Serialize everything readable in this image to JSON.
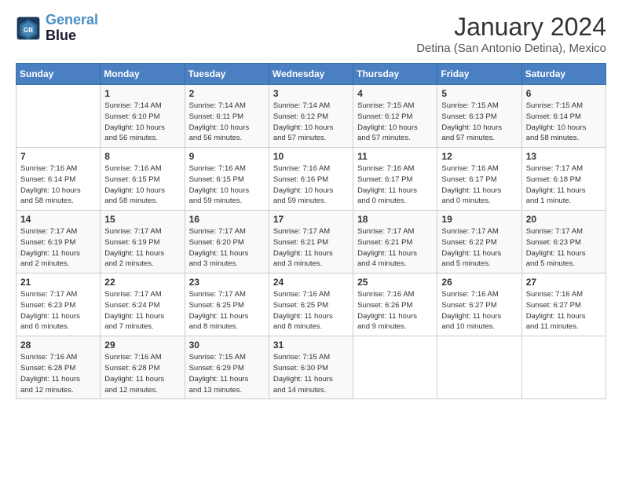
{
  "header": {
    "logo": {
      "line1": "General",
      "line2": "Blue"
    },
    "title": "January 2024",
    "subtitle": "Detina (San Antonio Detina), Mexico"
  },
  "days_of_week": [
    "Sunday",
    "Monday",
    "Tuesday",
    "Wednesday",
    "Thursday",
    "Friday",
    "Saturday"
  ],
  "weeks": [
    [
      {
        "day": "",
        "info": ""
      },
      {
        "day": "1",
        "info": "Sunrise: 7:14 AM\nSunset: 6:10 PM\nDaylight: 10 hours\nand 56 minutes."
      },
      {
        "day": "2",
        "info": "Sunrise: 7:14 AM\nSunset: 6:11 PM\nDaylight: 10 hours\nand 56 minutes."
      },
      {
        "day": "3",
        "info": "Sunrise: 7:14 AM\nSunset: 6:12 PM\nDaylight: 10 hours\nand 57 minutes."
      },
      {
        "day": "4",
        "info": "Sunrise: 7:15 AM\nSunset: 6:12 PM\nDaylight: 10 hours\nand 57 minutes."
      },
      {
        "day": "5",
        "info": "Sunrise: 7:15 AM\nSunset: 6:13 PM\nDaylight: 10 hours\nand 57 minutes."
      },
      {
        "day": "6",
        "info": "Sunrise: 7:15 AM\nSunset: 6:14 PM\nDaylight: 10 hours\nand 58 minutes."
      }
    ],
    [
      {
        "day": "7",
        "info": "Sunrise: 7:16 AM\nSunset: 6:14 PM\nDaylight: 10 hours\nand 58 minutes."
      },
      {
        "day": "8",
        "info": "Sunrise: 7:16 AM\nSunset: 6:15 PM\nDaylight: 10 hours\nand 58 minutes."
      },
      {
        "day": "9",
        "info": "Sunrise: 7:16 AM\nSunset: 6:15 PM\nDaylight: 10 hours\nand 59 minutes."
      },
      {
        "day": "10",
        "info": "Sunrise: 7:16 AM\nSunset: 6:16 PM\nDaylight: 10 hours\nand 59 minutes."
      },
      {
        "day": "11",
        "info": "Sunrise: 7:16 AM\nSunset: 6:17 PM\nDaylight: 11 hours\nand 0 minutes."
      },
      {
        "day": "12",
        "info": "Sunrise: 7:16 AM\nSunset: 6:17 PM\nDaylight: 11 hours\nand 0 minutes."
      },
      {
        "day": "13",
        "info": "Sunrise: 7:17 AM\nSunset: 6:18 PM\nDaylight: 11 hours\nand 1 minute."
      }
    ],
    [
      {
        "day": "14",
        "info": "Sunrise: 7:17 AM\nSunset: 6:19 PM\nDaylight: 11 hours\nand 2 minutes."
      },
      {
        "day": "15",
        "info": "Sunrise: 7:17 AM\nSunset: 6:19 PM\nDaylight: 11 hours\nand 2 minutes."
      },
      {
        "day": "16",
        "info": "Sunrise: 7:17 AM\nSunset: 6:20 PM\nDaylight: 11 hours\nand 3 minutes."
      },
      {
        "day": "17",
        "info": "Sunrise: 7:17 AM\nSunset: 6:21 PM\nDaylight: 11 hours\nand 3 minutes."
      },
      {
        "day": "18",
        "info": "Sunrise: 7:17 AM\nSunset: 6:21 PM\nDaylight: 11 hours\nand 4 minutes."
      },
      {
        "day": "19",
        "info": "Sunrise: 7:17 AM\nSunset: 6:22 PM\nDaylight: 11 hours\nand 5 minutes."
      },
      {
        "day": "20",
        "info": "Sunrise: 7:17 AM\nSunset: 6:23 PM\nDaylight: 11 hours\nand 5 minutes."
      }
    ],
    [
      {
        "day": "21",
        "info": "Sunrise: 7:17 AM\nSunset: 6:23 PM\nDaylight: 11 hours\nand 6 minutes."
      },
      {
        "day": "22",
        "info": "Sunrise: 7:17 AM\nSunset: 6:24 PM\nDaylight: 11 hours\nand 7 minutes."
      },
      {
        "day": "23",
        "info": "Sunrise: 7:17 AM\nSunset: 6:25 PM\nDaylight: 11 hours\nand 8 minutes."
      },
      {
        "day": "24",
        "info": "Sunrise: 7:16 AM\nSunset: 6:25 PM\nDaylight: 11 hours\nand 8 minutes."
      },
      {
        "day": "25",
        "info": "Sunrise: 7:16 AM\nSunset: 6:26 PM\nDaylight: 11 hours\nand 9 minutes."
      },
      {
        "day": "26",
        "info": "Sunrise: 7:16 AM\nSunset: 6:27 PM\nDaylight: 11 hours\nand 10 minutes."
      },
      {
        "day": "27",
        "info": "Sunrise: 7:16 AM\nSunset: 6:27 PM\nDaylight: 11 hours\nand 11 minutes."
      }
    ],
    [
      {
        "day": "28",
        "info": "Sunrise: 7:16 AM\nSunset: 6:28 PM\nDaylight: 11 hours\nand 12 minutes."
      },
      {
        "day": "29",
        "info": "Sunrise: 7:16 AM\nSunset: 6:28 PM\nDaylight: 11 hours\nand 12 minutes."
      },
      {
        "day": "30",
        "info": "Sunrise: 7:15 AM\nSunset: 6:29 PM\nDaylight: 11 hours\nand 13 minutes."
      },
      {
        "day": "31",
        "info": "Sunrise: 7:15 AM\nSunset: 6:30 PM\nDaylight: 11 hours\nand 14 minutes."
      },
      {
        "day": "",
        "info": ""
      },
      {
        "day": "",
        "info": ""
      },
      {
        "day": "",
        "info": ""
      }
    ]
  ]
}
